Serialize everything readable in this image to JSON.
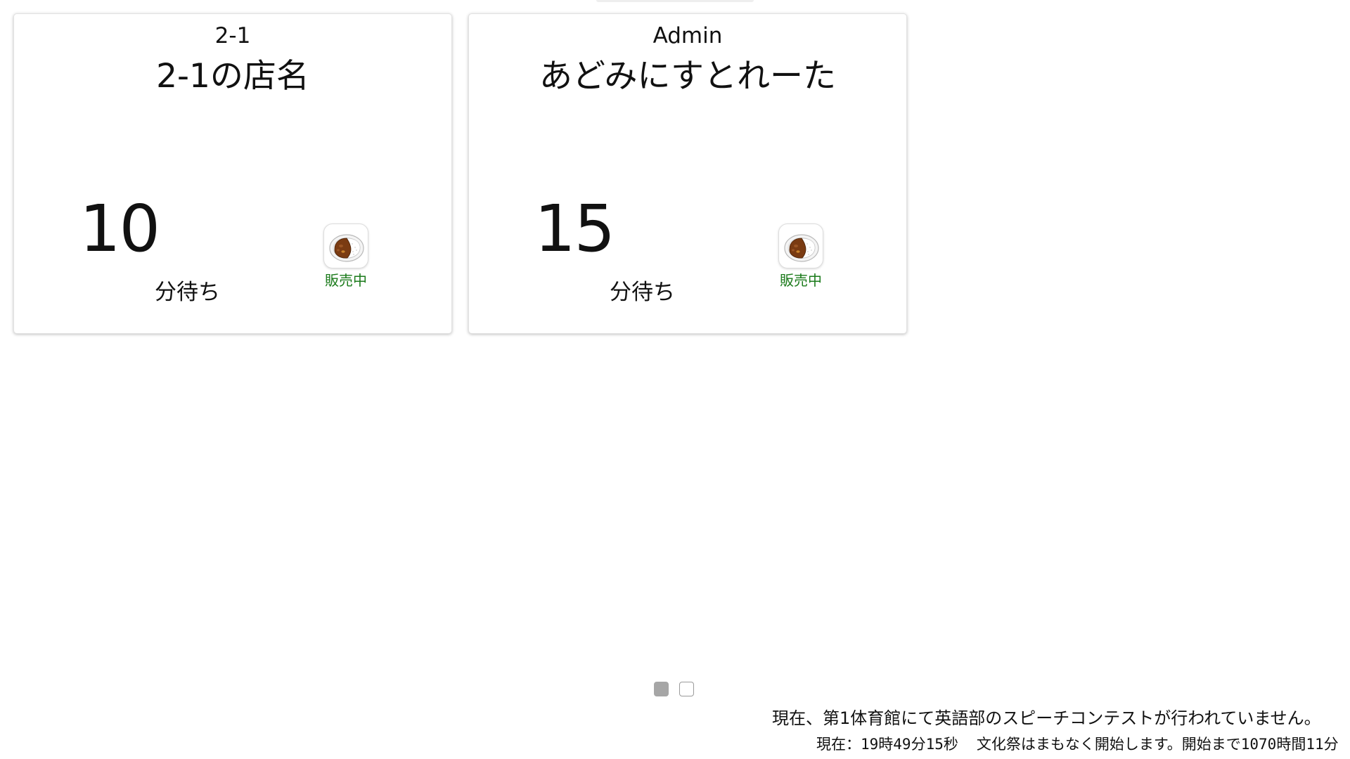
{
  "cards": [
    {
      "class_name": "2-1",
      "shop_name": "2-1の店名",
      "wait_time": "10",
      "wait_unit": "分待ち",
      "menu_icon": "curry-rice-icon",
      "sale_status": "販売中"
    },
    {
      "class_name": "Admin",
      "shop_name": "あどみにすとれーた",
      "wait_time": "15",
      "wait_unit": "分待ち",
      "menu_icon": "curry-rice-icon",
      "sale_status": "販売中"
    }
  ],
  "pagination": {
    "pages": 2,
    "current": 1
  },
  "footer": {
    "announcement": "現在、第1体育館にて英語部のスピーチコンテストが行われていません。",
    "clock": "現在：19時49分15秒",
    "countdown": "文化祭はまもなく開始します。開始まで1070時間11分"
  },
  "colors": {
    "status_green": "#1a7a1a",
    "dot_active": "#a6a6a6",
    "card_border": "#e2e2e2"
  }
}
